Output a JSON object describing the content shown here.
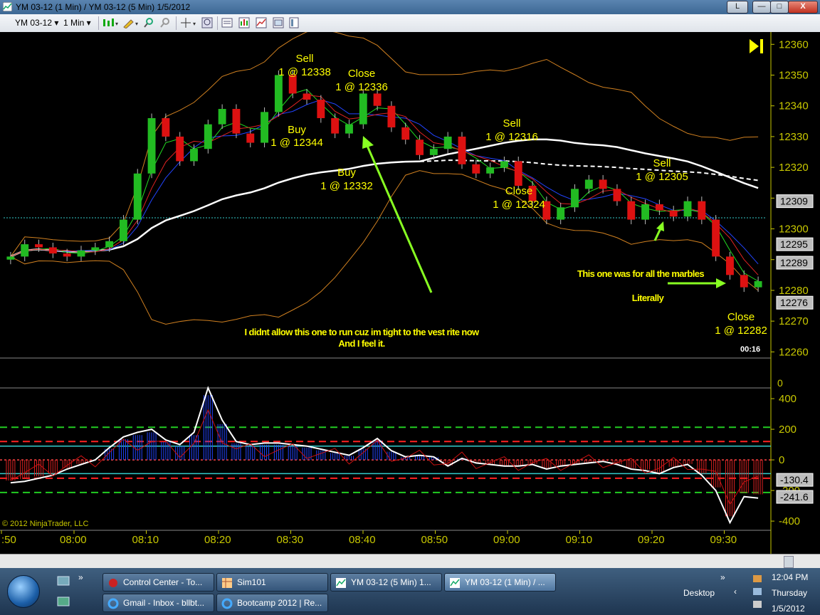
{
  "window": {
    "title": "YM 03-12 (1 Min) / YM 03-12 (5 Min)  1/5/2012",
    "btn_l": "L",
    "btn_min": "—",
    "btn_max": "□",
    "btn_close": "X"
  },
  "toolbar": {
    "instrument": "YM 03-12 ▾",
    "interval": "1 Min ▾"
  },
  "colors": {
    "bg": "#000000",
    "axis": "#c8c800",
    "annotation": "#ffff00",
    "up": "#22bb22",
    "down": "#dd1111"
  },
  "chart_data": [
    {
      "type": "candlestick",
      "title": "",
      "x_ticks": [
        ":50",
        "08:00",
        "08:10",
        "08:20",
        "08:30",
        "08:40",
        "08:50",
        "09:00",
        "09:10",
        "09:20",
        "09:30"
      ],
      "y_ticks": [
        12360,
        12350,
        12340,
        12330,
        12320,
        12310,
        12300,
        12290,
        12280,
        12270,
        12260
      ],
      "ylim": [
        12258,
        12364
      ],
      "price_markers": [
        12309,
        12295,
        12289,
        12276
      ],
      "timer": "00:16",
      "close_approx": [
        12291,
        12295,
        12294,
        12292,
        12291,
        12293,
        12294,
        12296,
        12303,
        12318,
        12336,
        12330,
        12322,
        12326,
        12334,
        12339,
        12331,
        12328,
        12338,
        12350,
        12344,
        12342,
        12336,
        12331,
        12334,
        12344,
        12340,
        12333,
        12329,
        12324,
        12326,
        12330,
        12321,
        12318,
        12320,
        12322,
        12314,
        12309,
        12303,
        12307,
        12313,
        12316,
        12313,
        12309,
        12303,
        12308,
        12306,
        12304,
        12309,
        12303,
        12291,
        12285,
        12281,
        12283
      ],
      "annotations": [
        {
          "line1": "Sell",
          "line2": "1 @ 12338"
        },
        {
          "line1": "Close",
          "line2": "1 @ 12336"
        },
        {
          "line1": "Buy",
          "line2": "1 @ 12344"
        },
        {
          "line1": "Buy",
          "line2": "1 @ 12332"
        },
        {
          "line1": "Sell",
          "line2": "1 @ 12316"
        },
        {
          "line1": "Close",
          "line2": "1 @ 12324"
        },
        {
          "line1": "Sell",
          "line2": "1 @ 12305"
        },
        {
          "line1": "Close",
          "line2": "1 @ 12282"
        }
      ],
      "comments": [
        "I didnt allow this one to run cuz im tight to the vest rite now",
        "And I feel it.",
        "This one was for all the marbles",
        "Literally"
      ]
    },
    {
      "type": "line",
      "title": "",
      "y_ticks": [
        400,
        200,
        0,
        -200,
        -400
      ],
      "ylim": [
        -460,
        470
      ],
      "levels": [
        213,
        120,
        -120,
        -213
      ],
      "markers": [
        "-130.4",
        "-241.6"
      ],
      "extra_axis_label": "0",
      "values_approx": [
        -150,
        -140,
        -120,
        -100,
        -60,
        -30,
        0,
        80,
        150,
        180,
        200,
        130,
        100,
        180,
        470,
        260,
        120,
        100,
        110,
        110,
        100,
        90,
        70,
        50,
        30,
        80,
        140,
        60,
        20,
        30,
        20,
        -40,
        10,
        -20,
        -30,
        -40,
        -40,
        -30,
        -60,
        -40,
        -30,
        -20,
        -10,
        -30,
        -60,
        -70,
        -90,
        -50,
        -30,
        -100,
        -200,
        -410,
        -240,
        -250
      ]
    }
  ],
  "copyright": "© 2012 NinjaTrader, LLC",
  "taskbar": {
    "items": [
      {
        "label": "Control Center - To..."
      },
      {
        "label": "Sim101"
      },
      {
        "label": "YM 03-12 (5 Min)  1..."
      },
      {
        "label": "YM 03-12 (1 Min) / ..."
      },
      {
        "label": "Gmail - Inbox - bllbt..."
      },
      {
        "label": "Bootcamp 2012 | Re..."
      }
    ],
    "desktop": "Desktop",
    "chevron": "»",
    "time": "12:04 PM",
    "day": "Thursday",
    "date": "1/5/2012"
  }
}
